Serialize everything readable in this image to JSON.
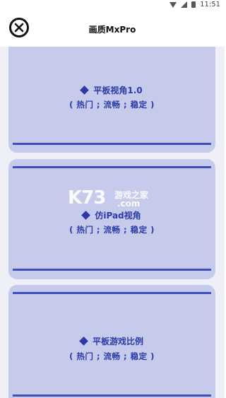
{
  "status_bar": {
    "time": "11:51"
  },
  "header": {
    "title": "画质MxPro"
  },
  "cards": [
    {
      "name": "平板视角1.0",
      "tags": "( 热门 ; 流畅 ; 稳定 )"
    },
    {
      "name": "仿iPad视角",
      "tags": "( 热门 ; 流畅 ; 稳定 )"
    },
    {
      "name": "平板游戏比例",
      "tags": "( 热门 ; 流畅 ; 稳定 )"
    }
  ],
  "watermark": {
    "logo": "K73",
    "tagline": "游戏之家",
    "domain": ".com"
  },
  "colors": {
    "card_bg": "#c7cbeb",
    "accent": "#3f4fbf",
    "page_bg": "#eff0f7"
  }
}
